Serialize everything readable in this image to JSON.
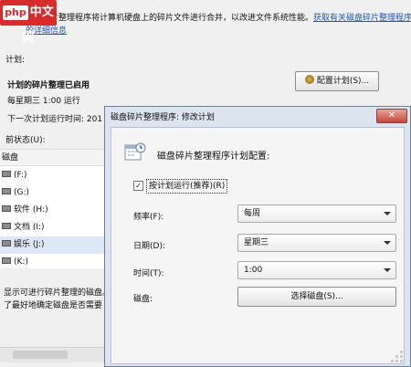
{
  "watermark": {
    "logo_text": "php",
    "logo_chinese": "中文网"
  },
  "description": {
    "text": "磁盘碎片整理程序将计算机硬盘上的碎片文件进行合并，以改进文件系统性能。",
    "link1": "获取有关磁盘碎片整理程序",
    "link2": "的详细信息"
  },
  "schedule_section": {
    "label": "计划:",
    "status_title": "计划的碎片整理已启用",
    "run_time": "每星期三  1:00 运行",
    "next_run": "下一次计划运行时间: 201",
    "config_button": "配置计划(S)..."
  },
  "status_section": {
    "label": "前状态(U):",
    "column_header": "磁盘",
    "disks": [
      {
        "label": "(F:)"
      },
      {
        "label": "(G:)"
      },
      {
        "label": "软件 (H:)"
      },
      {
        "label": "文档 (I:)"
      },
      {
        "label": "娱乐 (J:)"
      },
      {
        "label": "(K:)"
      }
    ],
    "info_line1": "显示可进行碎片整理的磁盘。",
    "info_line2": "了最好地确定磁盘是否需要"
  },
  "dialog": {
    "title": "磁盘碎片整理程序: 修改计划",
    "close_symbol": "✕",
    "heading": "磁盘碎片整理程序计划配置:",
    "checkbox_label": "按计划运行(推荐)(R)",
    "checkbox_checked": true,
    "frequency_label": "频率(F):",
    "frequency_value": "每周",
    "day_label": "日期(D):",
    "day_value": "星期三",
    "time_label": "时间(T):",
    "time_value": "1:00",
    "disk_label": "磁盘:",
    "select_disk_button": "选择磁盘(S)..."
  },
  "colors": {
    "link": "#2456b3",
    "dialog_frame": "#dbe4ef",
    "close_button": "#c6463a"
  }
}
